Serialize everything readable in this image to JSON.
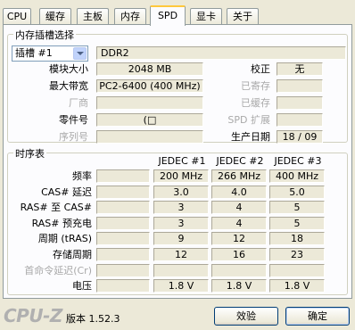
{
  "tabs": [
    "CPU",
    "缓存",
    "主板",
    "内存",
    "SPD",
    "显卡",
    "关于"
  ],
  "active_tab": "SPD",
  "slot_group": {
    "legend": "内存插槽选择",
    "slot_select": "插槽 #1",
    "memory_type": "DDR2",
    "module_size_label": "模块大小",
    "module_size": "2048 MB",
    "max_bandwidth_label": "最大带宽",
    "max_bandwidth": "PC2-6400 (400 MHz)",
    "manufacturer_label": "厂商",
    "manufacturer": "",
    "part_number_label": "零件号",
    "part_number": "(□",
    "serial_label": "序列号",
    "serial": "",
    "ecc_label": "校正",
    "ecc": "无",
    "registered_label": "已寄存",
    "registered": "",
    "buffered_label": "已缓存",
    "buffered": "",
    "spd_ext_label": "SPD 扩展",
    "spd_ext": "",
    "mfg_date_label": "生产日期",
    "mfg_date": "18 / 09"
  },
  "timing_group": {
    "legend": "时序表",
    "columns": [
      "JEDEC #1",
      "JEDEC #2",
      "JEDEC #3"
    ],
    "rows": [
      {
        "label": "频率",
        "values": [
          "200 MHz",
          "266 MHz",
          "400 MHz"
        ],
        "dim": false
      },
      {
        "label": "CAS# 延迟",
        "values": [
          "3.0",
          "4.0",
          "5.0"
        ],
        "dim": false
      },
      {
        "label": "RAS# 至 CAS#",
        "values": [
          "3",
          "4",
          "5"
        ],
        "dim": false
      },
      {
        "label": "RAS# 预充电",
        "values": [
          "3",
          "4",
          "5"
        ],
        "dim": false
      },
      {
        "label": "周期 (tRAS)",
        "values": [
          "9",
          "12",
          "18"
        ],
        "dim": false
      },
      {
        "label": "存储周期",
        "values": [
          "12",
          "16",
          "23"
        ],
        "dim": false
      },
      {
        "label": "首命令延迟(Cr)",
        "values": [
          "",
          "",
          ""
        ],
        "dim": true
      },
      {
        "label": "电压",
        "values": [
          "1.8 V",
          "1.8 V",
          "1.8 V"
        ],
        "dim": false
      }
    ]
  },
  "footer": {
    "brand": "CPU-Z",
    "version": "版本 1.52.3",
    "validate_label": "效验",
    "ok_label": "确定"
  }
}
